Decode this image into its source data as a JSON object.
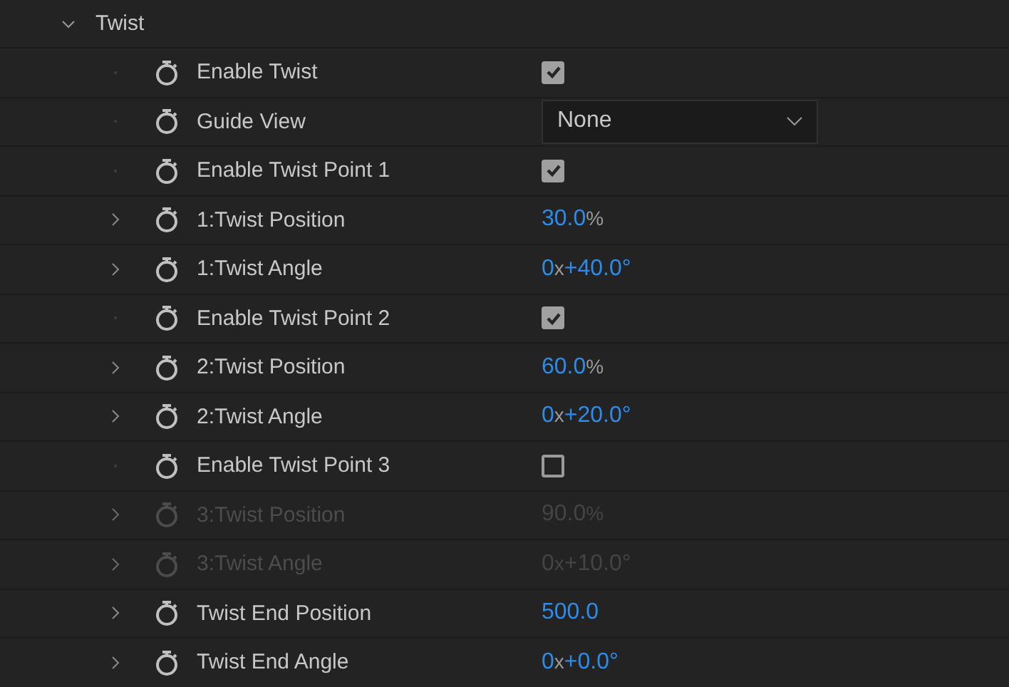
{
  "group": {
    "title": "Twist",
    "expanded": true
  },
  "rows": [
    {
      "label": "Enable Twist",
      "expandable": false,
      "disabled": false,
      "kind": "checkbox",
      "checked": true
    },
    {
      "label": "Guide View",
      "expandable": false,
      "disabled": false,
      "kind": "dropdown",
      "value": "None"
    },
    {
      "label": "Enable Twist Point 1",
      "expandable": false,
      "disabled": false,
      "kind": "checkbox",
      "checked": true
    },
    {
      "label": "1:Twist Position",
      "expandable": true,
      "disabled": false,
      "kind": "number",
      "value": [
        {
          "text": "30.0",
          "kind": "number"
        },
        {
          "text": "%",
          "kind": "unit"
        }
      ]
    },
    {
      "label": "1:Twist Angle",
      "expandable": true,
      "disabled": false,
      "kind": "number",
      "value": [
        {
          "text": "0",
          "kind": "number"
        },
        {
          "text": "x",
          "kind": "unit"
        },
        {
          "text": "+40.0°",
          "kind": "number"
        }
      ]
    },
    {
      "label": "Enable Twist Point 2",
      "expandable": false,
      "disabled": false,
      "kind": "checkbox",
      "checked": true
    },
    {
      "label": "2:Twist Position",
      "expandable": true,
      "disabled": false,
      "kind": "number",
      "value": [
        {
          "text": "60.0",
          "kind": "number"
        },
        {
          "text": "%",
          "kind": "unit"
        }
      ]
    },
    {
      "label": "2:Twist Angle",
      "expandable": true,
      "disabled": false,
      "kind": "number",
      "value": [
        {
          "text": "0",
          "kind": "number"
        },
        {
          "text": "x",
          "kind": "unit"
        },
        {
          "text": "+20.0°",
          "kind": "number"
        }
      ]
    },
    {
      "label": "Enable Twist Point 3",
      "expandable": false,
      "disabled": false,
      "kind": "checkbox",
      "checked": false
    },
    {
      "label": "3:Twist Position",
      "expandable": true,
      "disabled": true,
      "kind": "number",
      "value": [
        {
          "text": "90.0",
          "kind": "number"
        },
        {
          "text": "%",
          "kind": "unit"
        }
      ]
    },
    {
      "label": "3:Twist Angle",
      "expandable": true,
      "disabled": true,
      "kind": "number",
      "value": [
        {
          "text": "0",
          "kind": "number"
        },
        {
          "text": "x",
          "kind": "unit"
        },
        {
          "text": "+10.0°",
          "kind": "number"
        }
      ]
    },
    {
      "label": "Twist End Position",
      "expandable": true,
      "disabled": false,
      "kind": "number",
      "value": [
        {
          "text": "500.0",
          "kind": "number"
        }
      ]
    },
    {
      "label": "Twist End Angle",
      "expandable": true,
      "disabled": false,
      "kind": "number",
      "value": [
        {
          "text": "0",
          "kind": "number"
        },
        {
          "text": "x",
          "kind": "unit"
        },
        {
          "text": "+0.0°",
          "kind": "number"
        }
      ]
    }
  ]
}
